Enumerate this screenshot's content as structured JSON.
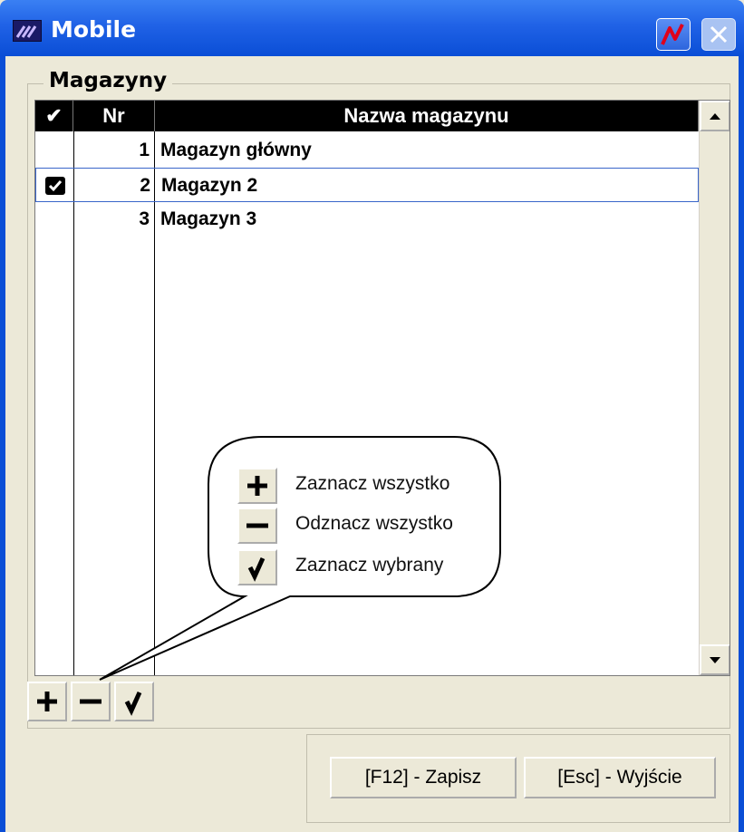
{
  "window": {
    "title": "Mobile"
  },
  "group": {
    "label": "Magazyny"
  },
  "grid": {
    "columns": {
      "check": "✔",
      "nr": "Nr",
      "name": "Nazwa magazynu"
    },
    "rows": [
      {
        "nr": "1",
        "name": "Magazyn główny",
        "checked": false
      },
      {
        "nr": "2",
        "name": "Magazyn 2",
        "checked": true
      },
      {
        "nr": "3",
        "name": "Magazyn 3",
        "checked": false
      }
    ]
  },
  "legend": {
    "select_all": "Zaznacz wszystko",
    "deselect_all": "Odznacz wszystko",
    "select_chosen": "Zaznacz wybrany"
  },
  "buttons": {
    "save": "[F12] - Zapisz",
    "exit": "[Esc] - Wyjście"
  }
}
